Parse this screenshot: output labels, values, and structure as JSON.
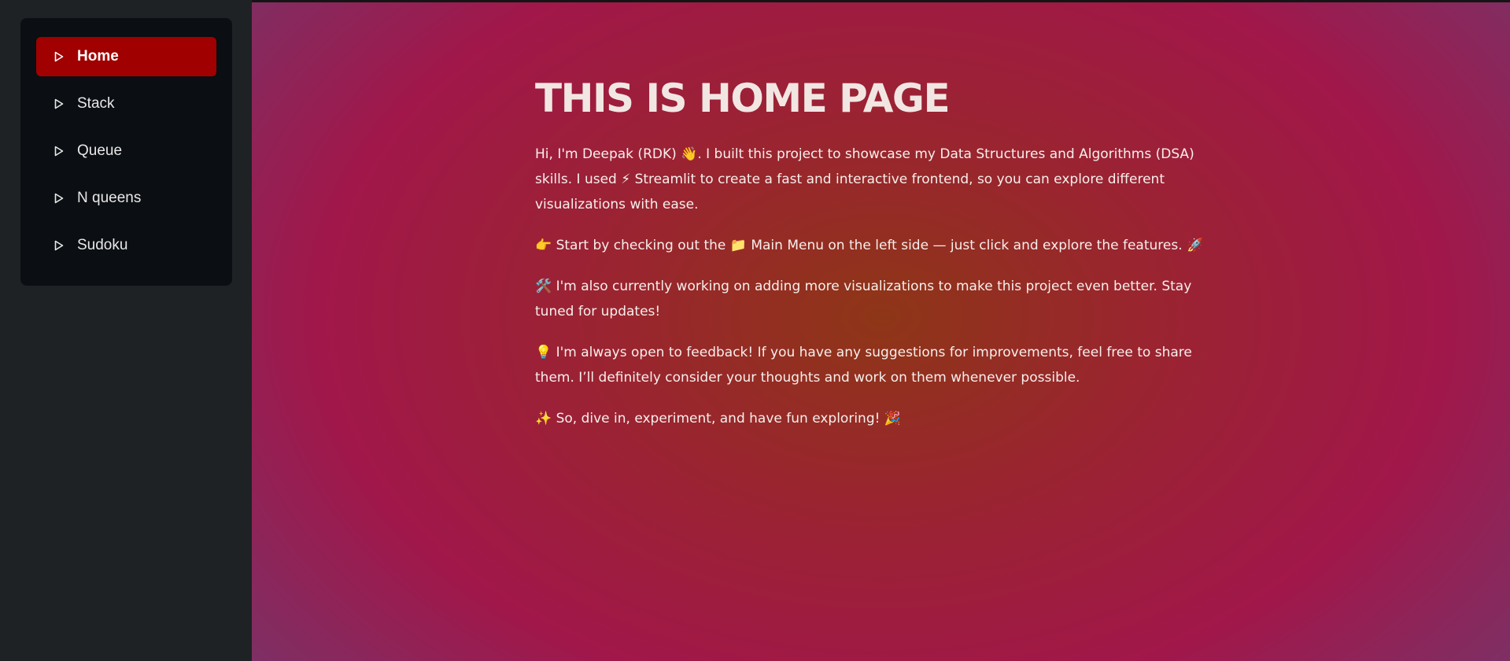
{
  "sidebar": {
    "items": [
      {
        "label": "Home",
        "icon": "play-triangle-icon",
        "active": true
      },
      {
        "label": "Stack",
        "icon": "play-triangle-icon",
        "active": false
      },
      {
        "label": "Queue",
        "icon": "play-triangle-icon",
        "active": false
      },
      {
        "label": "N queens",
        "icon": "play-triangle-icon",
        "active": false
      },
      {
        "label": "Sudoku",
        "icon": "play-triangle-icon",
        "active": false
      }
    ]
  },
  "main": {
    "title": "THIS IS HOME PAGE",
    "paragraphs": [
      "Hi, I'm Deepak (RDK) 👋. I built this project to showcase my Data Structures and Algorithms (DSA) skills. I used ⚡ Streamlit to create a fast and interactive frontend, so you can explore different visualizations with ease.",
      "👉 Start by checking out the 📁 Main Menu on the left side — just click and explore the features. 🚀",
      "🛠️ I'm also currently working on adding more visualizations to make this project even better. Stay tuned for updates!",
      "💡 I'm always open to feedback! If you have any suggestions for improvements, feel free to share them. I’ll definitely consider your thoughts and work on them whenever possible.",
      "✨ So, dive in, experiment, and have fun exploring! 🎉"
    ]
  },
  "colors": {
    "active_item": "#a00000",
    "sidebar_bg": "#1f2224",
    "menu_bg": "#0b0e12"
  }
}
